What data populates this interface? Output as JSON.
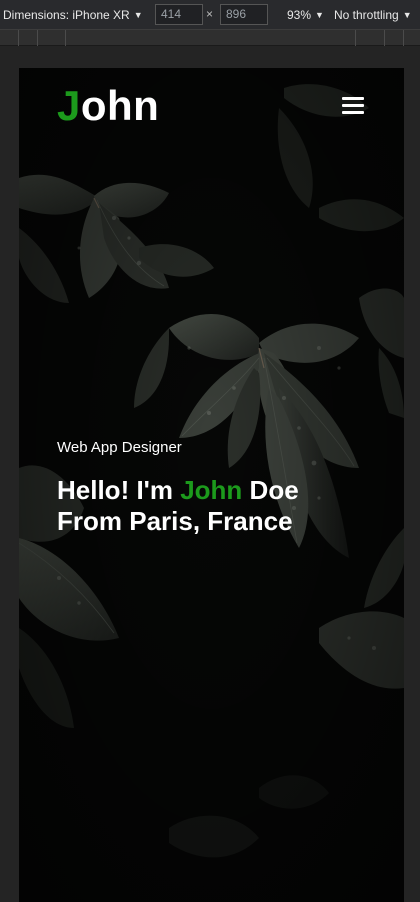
{
  "devtools": {
    "device_label": "Dimensions: iPhone XR",
    "width": "414",
    "height": "896",
    "zoom": "93%",
    "throttling": "No throttling"
  },
  "site": {
    "logo_first": "J",
    "logo_rest": "ohn",
    "subtitle": "Web App Designer",
    "headline_pre": "Hello! I'm ",
    "headline_name": "John",
    "headline_post": " Doe From Paris, France",
    "accent_color": "#1c9a1c",
    "menu_icon": "hamburger-menu-icon"
  }
}
